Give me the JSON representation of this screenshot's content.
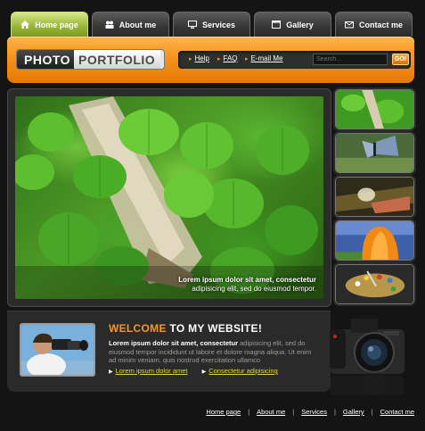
{
  "nav": {
    "tabs": [
      {
        "label": "Home page",
        "icon": "home-icon",
        "active": true
      },
      {
        "label": "About me",
        "icon": "people-icon",
        "active": false
      },
      {
        "label": "Services",
        "icon": "monitor-icon",
        "active": false
      },
      {
        "label": "Gallery",
        "icon": "window-icon",
        "active": false
      },
      {
        "label": "Contact me",
        "icon": "mail-icon",
        "active": false
      }
    ]
  },
  "header": {
    "logo_part1": "PHOTO",
    "logo_part2": "PORTFOLIO",
    "links": [
      "Help",
      "FAQ",
      "E-mail Me"
    ],
    "search_placeholder": "Search...",
    "search_button": "GO!"
  },
  "hero": {
    "caption_line1": "Lorem ipsum dolor sit amet, consectetur",
    "caption_line2": "adipisicing elit, sed do eiusmod tempor."
  },
  "thumbnails": [
    "clover",
    "butterfly",
    "glass",
    "tulip",
    "palette"
  ],
  "welcome": {
    "title_part1": "WELCOME",
    "title_part2": " TO MY WEBSITE!",
    "lead": "Lorem ipsum dolor sit amet, consectetur",
    "body": " adipisicing elit, sed do eiusmod tempor incididunt ut labore et dolore magna aliqua. Ut enim ad minim veniam, quis nostrud exercitation ullamco",
    "link1": "Lorem ipsum dolor amet",
    "link2": "Consectetur adipisicing"
  },
  "footer": {
    "links": [
      "Home page",
      "About me",
      "Services",
      "Gallery",
      "Contact me"
    ]
  },
  "colors": {
    "accent_orange": "#f6921e",
    "active_tab_green": "#9cb83a",
    "link_yellow": "#e6d63a",
    "background": "#141414"
  }
}
